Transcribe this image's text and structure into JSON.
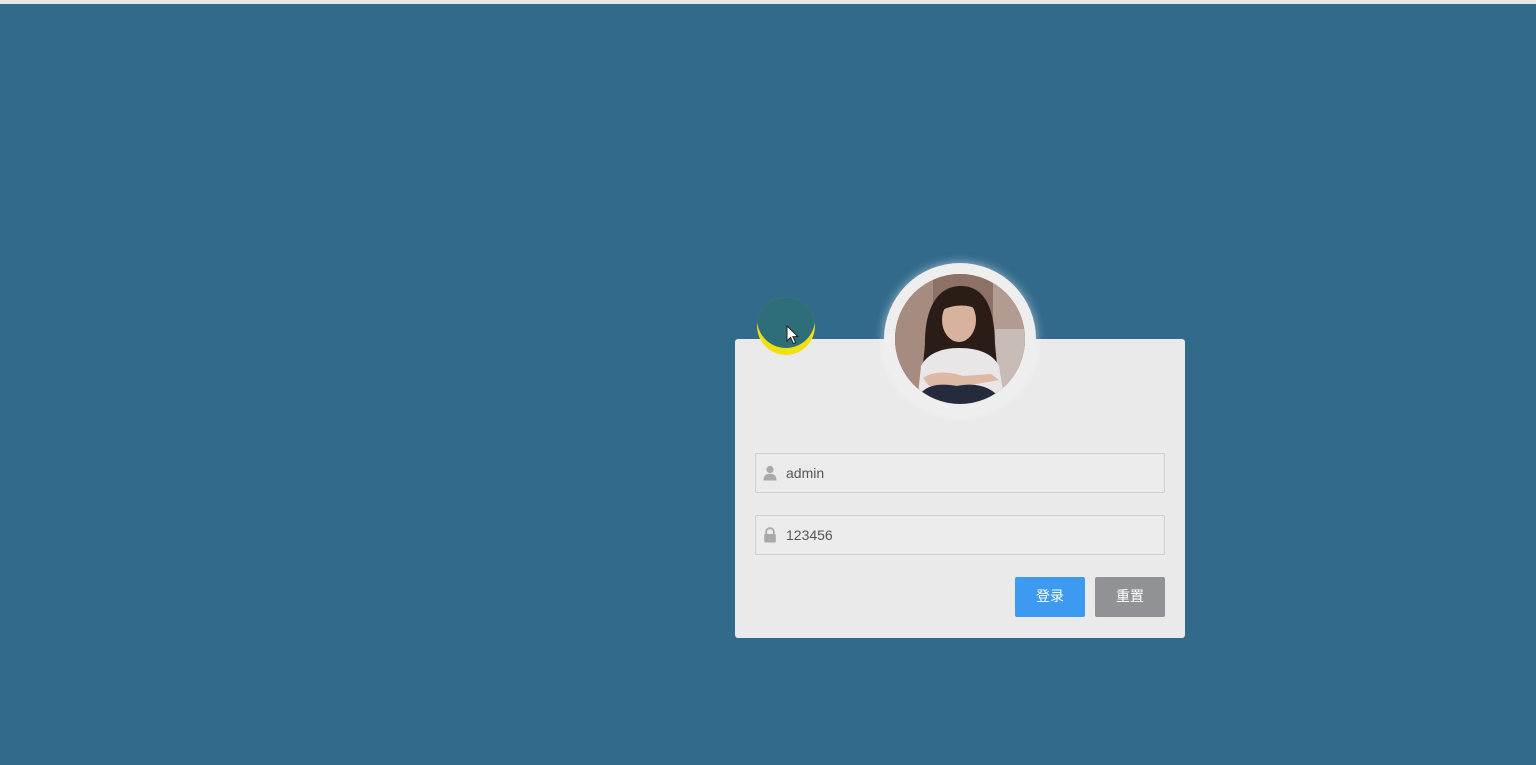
{
  "login": {
    "username": {
      "value": "admin",
      "placeholder": "",
      "icon": "user-icon"
    },
    "password": {
      "value": "123456",
      "placeholder": "",
      "icon": "lock-icon"
    },
    "login_label": "登录",
    "reset_label": "重置"
  },
  "colors": {
    "background": "#326a8c",
    "card": "#eaeaea",
    "login_button": "#3c9af0",
    "reset_button": "#909296",
    "click_marker_yellow": "#f0e010",
    "click_marker_teal": "#2d6e78"
  }
}
